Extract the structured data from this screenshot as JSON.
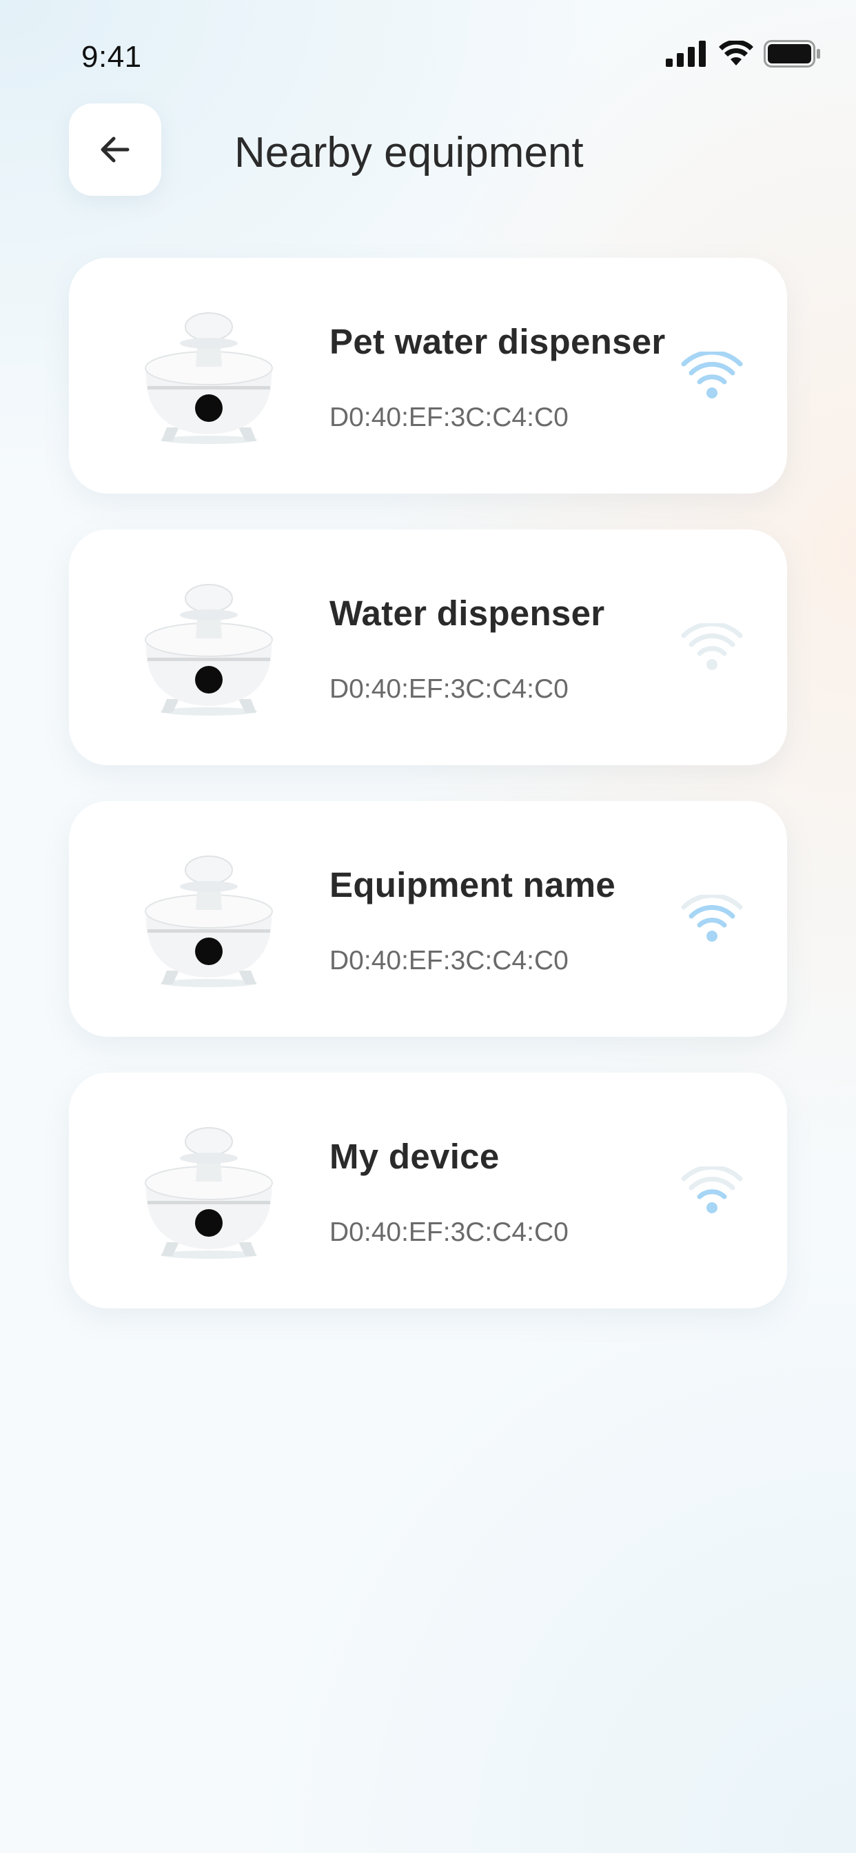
{
  "status_bar": {
    "time": "9:41"
  },
  "header": {
    "title": "Nearby equipment"
  },
  "devices": [
    {
      "name": "Pet water dispenser",
      "mac": "D0:40:EF:3C:C4:C0",
      "signal": "strong"
    },
    {
      "name": "Water dispenser",
      "mac": "D0:40:EF:3C:C4:C0",
      "signal": "none"
    },
    {
      "name": "Equipment name",
      "mac": "D0:40:EF:3C:C4:C0",
      "signal": "medium"
    },
    {
      "name": "My device",
      "mac": "D0:40:EF:3C:C4:C0",
      "signal": "weak"
    }
  ],
  "colors": {
    "signal_active": "#a6d5f5",
    "signal_inactive": "#e6eef2",
    "card": "#ffffff",
    "text": "#2a2a2a"
  }
}
